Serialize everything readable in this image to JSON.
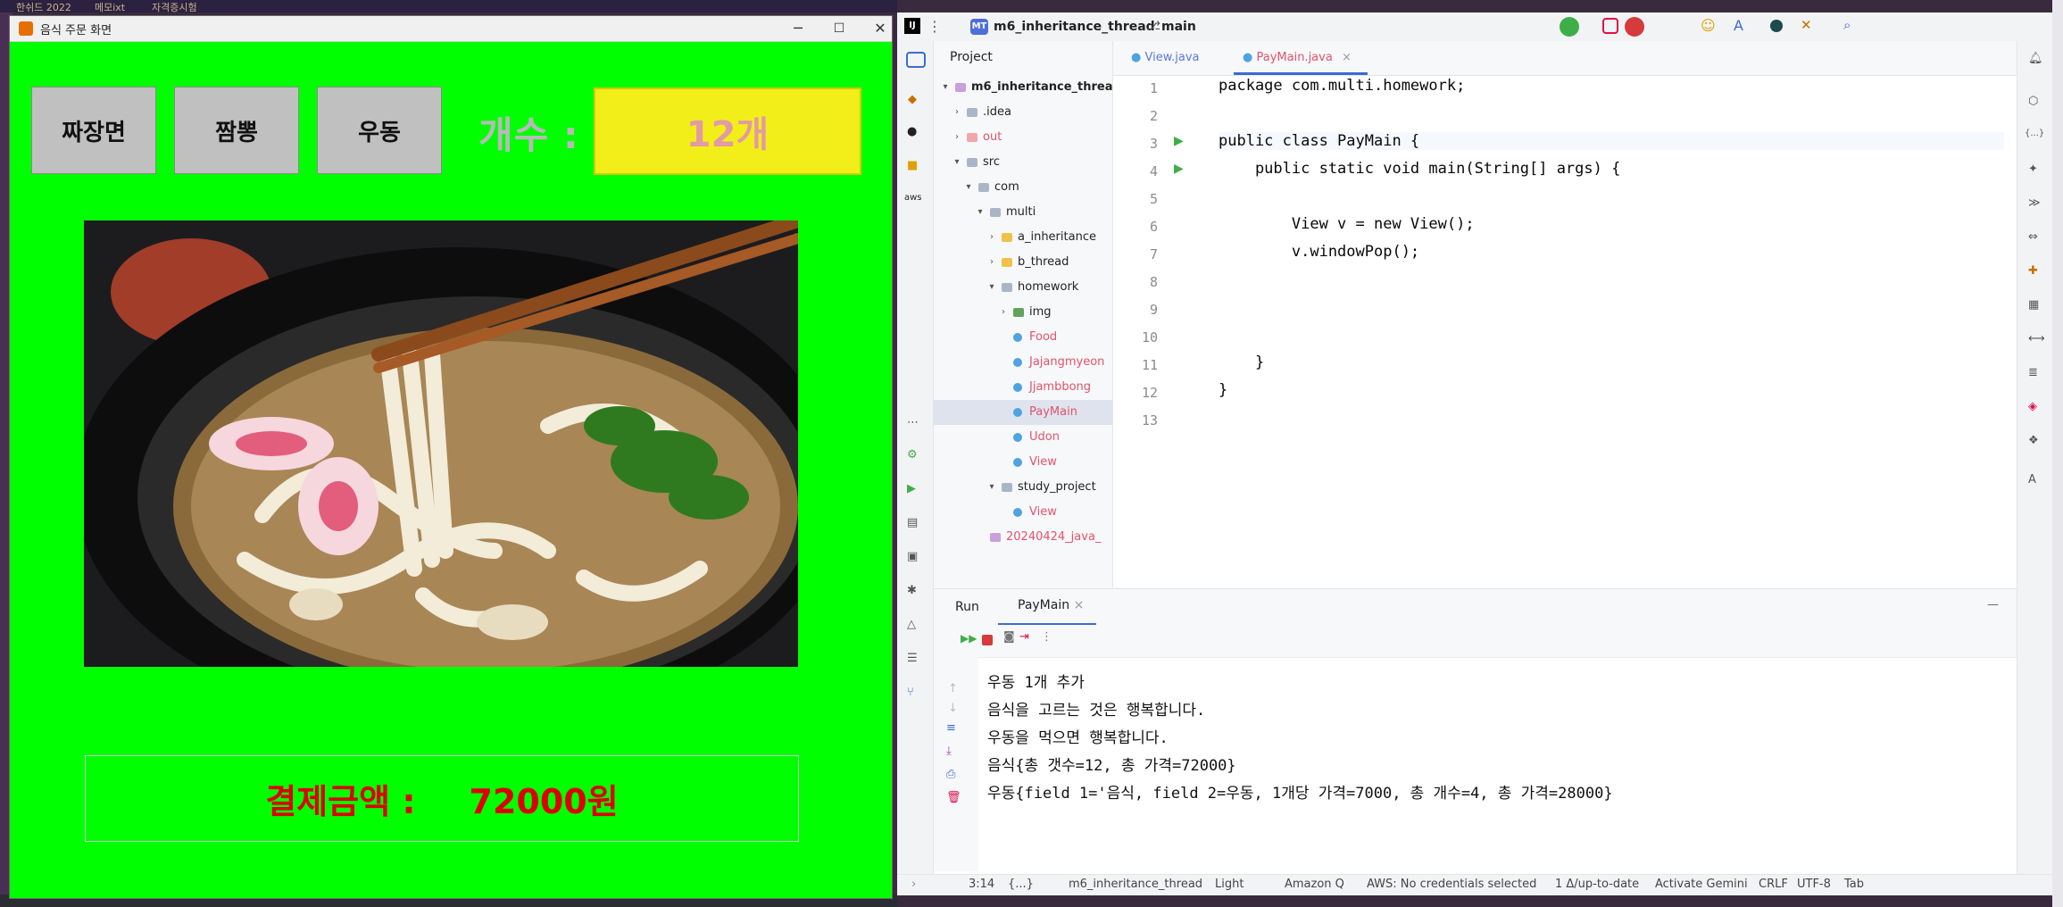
{
  "desktop": {
    "top_items": [
      "한쉬드 2022",
      "메모ixt",
      "자격증시험"
    ]
  },
  "swing_window": {
    "title": "음식 주문 화면",
    "controls": {
      "minimize": "─",
      "maximize": "☐",
      "close": "✕"
    },
    "buttons": [
      "짜장면",
      "짬뽕",
      "우동"
    ],
    "count_label": "개수 :",
    "count_value": "12개",
    "payment_label": "결제금액 :",
    "payment_value": "72000원",
    "image_alt": "udon bowl with chopsticks",
    "colors": {
      "background": "#00ff00",
      "count_box": "#f2ee1a",
      "payment_text": "#dd0000"
    }
  },
  "ide": {
    "project_badge": "MT",
    "project_name": "m6_inheritance_thread",
    "branch": "main",
    "panel_title": "Project",
    "tree": [
      {
        "label": "m6_inheritance_thread",
        "depth": 0,
        "type": "module",
        "expanded": true
      },
      {
        "label": ".idea",
        "depth": 1,
        "type": "folder",
        "expanded": false
      },
      {
        "label": "out",
        "depth": 1,
        "type": "folder-excluded",
        "expanded": false
      },
      {
        "label": "src",
        "depth": 1,
        "type": "folder",
        "expanded": true
      },
      {
        "label": "com",
        "depth": 2,
        "type": "package",
        "expanded": true
      },
      {
        "label": "multi",
        "depth": 3,
        "type": "package",
        "expanded": true
      },
      {
        "label": "a_inheritance",
        "depth": 4,
        "type": "package-yellow",
        "expanded": false
      },
      {
        "label": "b_thread",
        "depth": 4,
        "type": "package-yellow",
        "expanded": false
      },
      {
        "label": "homework",
        "depth": 4,
        "type": "package",
        "expanded": true
      },
      {
        "label": "img",
        "depth": 5,
        "type": "folder-res",
        "expanded": false
      },
      {
        "label": "Food",
        "depth": 5,
        "type": "class-red",
        "expanded": null
      },
      {
        "label": "Jajangmyeon",
        "depth": 5,
        "type": "class-red",
        "expanded": null
      },
      {
        "label": "Jjambbong",
        "depth": 5,
        "type": "class-red",
        "expanded": null
      },
      {
        "label": "PayMain",
        "depth": 5,
        "type": "class-red",
        "expanded": null,
        "selected": true
      },
      {
        "label": "Udon",
        "depth": 5,
        "type": "class-red",
        "expanded": null
      },
      {
        "label": "View",
        "depth": 5,
        "type": "class-red",
        "expanded": null
      },
      {
        "label": "study_project",
        "depth": 4,
        "type": "package",
        "expanded": true
      },
      {
        "label": "View",
        "depth": 5,
        "type": "class-red",
        "expanded": null
      },
      {
        "label": "20240424_java_",
        "depth": 3,
        "type": "file",
        "expanded": null
      }
    ],
    "tabs": [
      {
        "label": "View.java",
        "active": false
      },
      {
        "label": "PayMain.java",
        "active": true
      }
    ],
    "code_lines": [
      {
        "n": "1",
        "text": "package com.multi.homework;"
      },
      {
        "n": "2",
        "text": ""
      },
      {
        "n": "3",
        "text": "public class PayMain {"
      },
      {
        "n": "4",
        "text": "    public static void main(String[] args) {"
      },
      {
        "n": "5",
        "text": ""
      },
      {
        "n": "6",
        "text": "        View v = new View();"
      },
      {
        "n": "7",
        "text": "        v.windowPop();"
      },
      {
        "n": "8",
        "text": ""
      },
      {
        "n": "9",
        "text": ""
      },
      {
        "n": "10",
        "text": ""
      },
      {
        "n": "11",
        "text": "    }"
      },
      {
        "n": "12",
        "text": "}"
      },
      {
        "n": "13",
        "text": ""
      }
    ],
    "run_panel": {
      "tab_run": "Run",
      "tab_config": "PayMain",
      "console": [
        "우동 1개 추가",
        "음식을 고르는 것은 행복합니다.",
        "우동을 먹으면 행복합니다.",
        "음식{총 갯수=12, 총 가격=72000}",
        "우동{field 1='음식, field 2=우동, 1개당 가격=7000, 총 개수=4, 총 가격=28000}"
      ]
    },
    "status_bar": {
      "position": "3:14",
      "braces": "{...}",
      "project": "m6_inheritance_thread",
      "theme": "Light",
      "amazon_q": "Amazon Q",
      "aws": "AWS: No credentials selected",
      "vcs": "1 Δ/up-to-date",
      "gemini": "Activate Gemini",
      "line_sep": "CRLF",
      "encoding": "UTF-8",
      "indent": "Tab"
    }
  }
}
